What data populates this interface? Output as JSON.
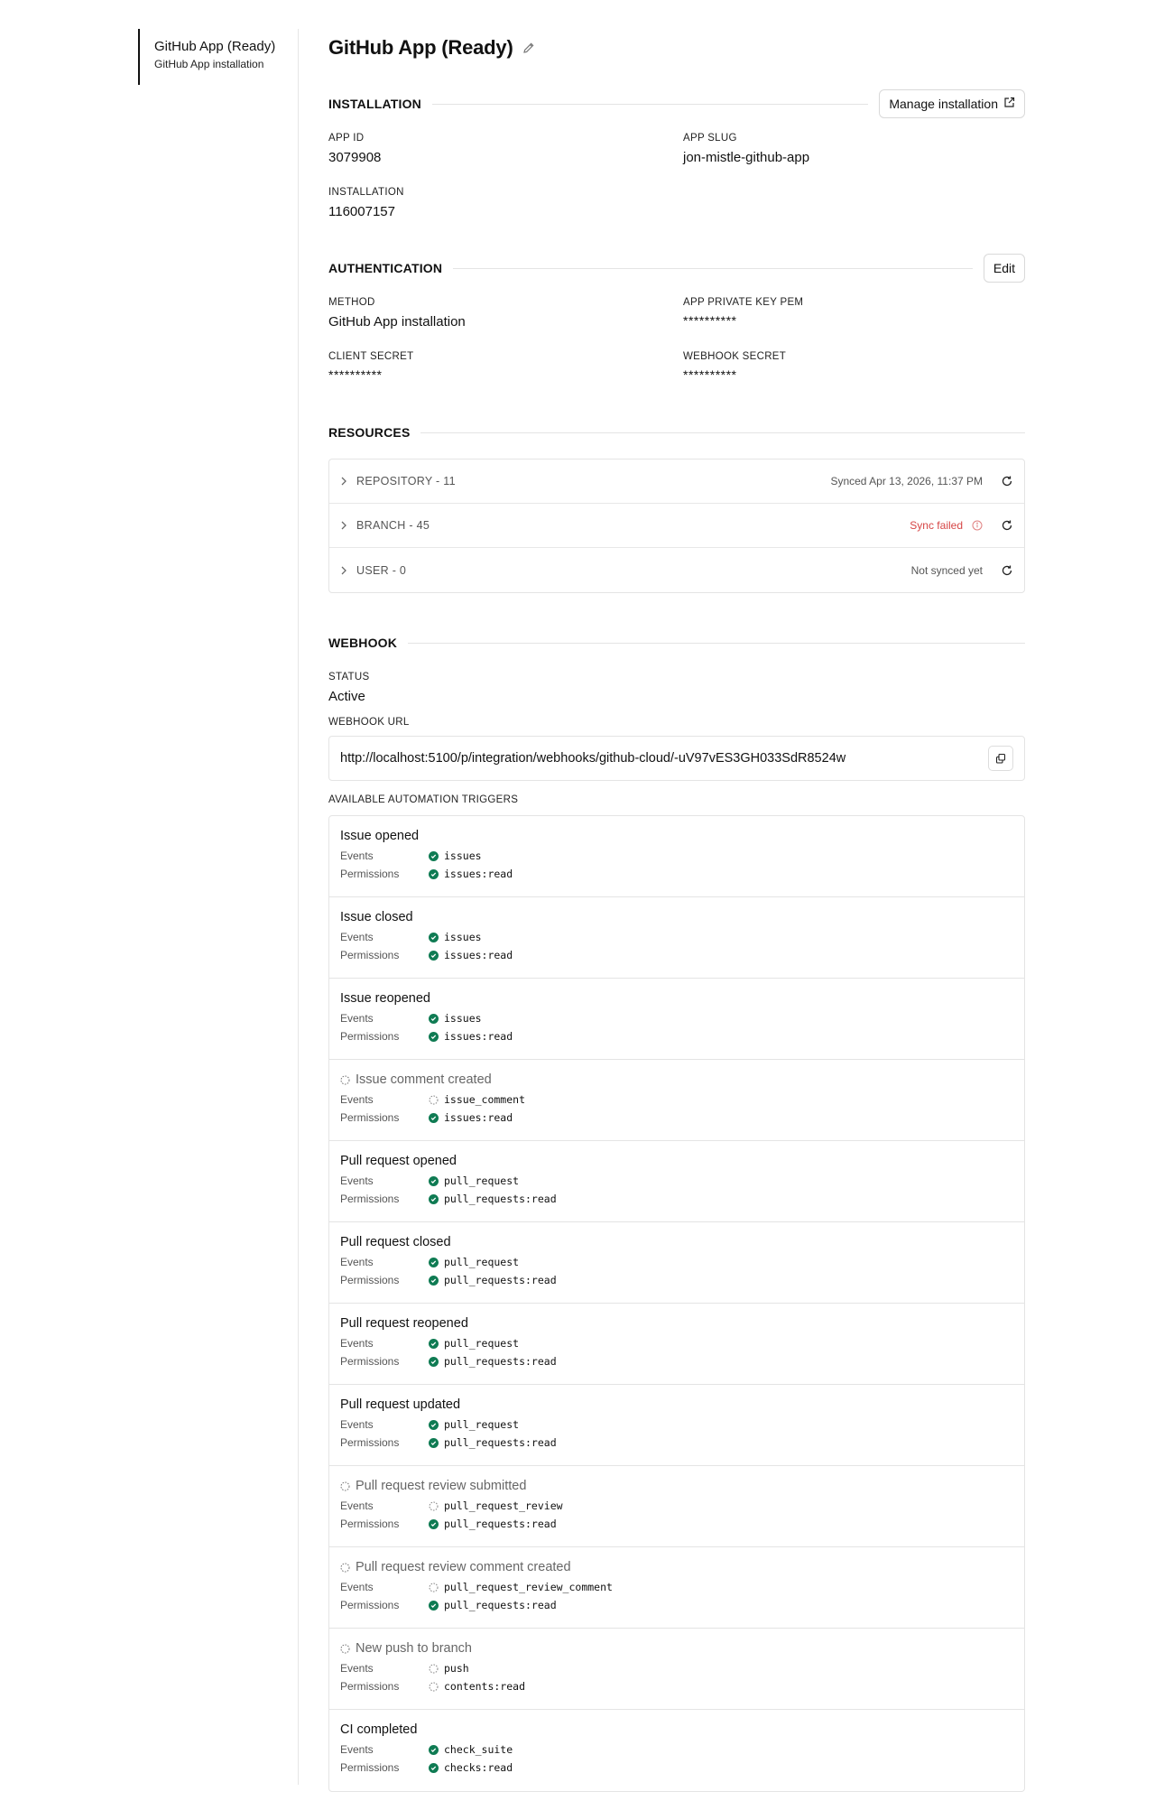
{
  "sidebar": {
    "item_title": "GitHub App (Ready)",
    "item_subtitle": "GitHub App installation"
  },
  "page": {
    "title": "GitHub App (Ready)",
    "edit_icon": "pencil-icon"
  },
  "installation": {
    "heading": "INSTALLATION",
    "manage_button": "Manage installation",
    "app_id_label": "APP ID",
    "app_id": "3079908",
    "app_slug_label": "APP SLUG",
    "app_slug": "jon-mistle-github-app",
    "installation_label": "INSTALLATION",
    "installation_value": "116007157"
  },
  "authentication": {
    "heading": "AUTHENTICATION",
    "edit_button": "Edit",
    "method_label": "METHOD",
    "method_value": "GitHub App installation",
    "pem_label": "APP PRIVATE KEY PEM",
    "pem_value": "**********",
    "client_secret_label": "CLIENT SECRET",
    "client_secret_value": "**********",
    "webhook_secret_label": "WEBHOOK SECRET",
    "webhook_secret_value": "**********"
  },
  "resources": {
    "heading": "RESOURCES",
    "rows": [
      {
        "label": "REPOSITORY - 11",
        "status": "Synced Apr 13, 2026, 11:37 PM",
        "state": "synced"
      },
      {
        "label": "BRANCH - 45",
        "status": "Sync failed",
        "state": "failed"
      },
      {
        "label": "USER - 0",
        "status": "Not synced yet",
        "state": "none"
      }
    ]
  },
  "webhook": {
    "heading": "WEBHOOK",
    "status_label": "STATUS",
    "status_value": "Active",
    "url_label": "WEBHOOK URL",
    "url_value": "http://localhost:5100/p/integration/webhooks/github-cloud/-uV97vES3GH033SdR8524w",
    "triggers_label": "AVAILABLE AUTOMATION TRIGGERS",
    "events_key": "Events",
    "permissions_key": "Permissions"
  },
  "triggers": [
    {
      "name": "Issue opened",
      "pending": false,
      "event": "issues",
      "event_ok": true,
      "permission": "issues:read",
      "permission_ok": true
    },
    {
      "name": "Issue closed",
      "pending": false,
      "event": "issues",
      "event_ok": true,
      "permission": "issues:read",
      "permission_ok": true
    },
    {
      "name": "Issue reopened",
      "pending": false,
      "event": "issues",
      "event_ok": true,
      "permission": "issues:read",
      "permission_ok": true
    },
    {
      "name": "Issue comment created",
      "pending": true,
      "event": "issue_comment",
      "event_ok": false,
      "permission": "issues:read",
      "permission_ok": true
    },
    {
      "name": "Pull request opened",
      "pending": false,
      "event": "pull_request",
      "event_ok": true,
      "permission": "pull_requests:read",
      "permission_ok": true
    },
    {
      "name": "Pull request closed",
      "pending": false,
      "event": "pull_request",
      "event_ok": true,
      "permission": "pull_requests:read",
      "permission_ok": true
    },
    {
      "name": "Pull request reopened",
      "pending": false,
      "event": "pull_request",
      "event_ok": true,
      "permission": "pull_requests:read",
      "permission_ok": true
    },
    {
      "name": "Pull request updated",
      "pending": false,
      "event": "pull_request",
      "event_ok": true,
      "permission": "pull_requests:read",
      "permission_ok": true
    },
    {
      "name": "Pull request review submitted",
      "pending": true,
      "event": "pull_request_review",
      "event_ok": false,
      "permission": "pull_requests:read",
      "permission_ok": true
    },
    {
      "name": "Pull request review comment created",
      "pending": true,
      "event": "pull_request_review_comment",
      "event_ok": false,
      "permission": "pull_requests:read",
      "permission_ok": true
    },
    {
      "name": "New push to branch",
      "pending": true,
      "event": "push",
      "event_ok": false,
      "permission": "contents:read",
      "permission_ok": false
    },
    {
      "name": "CI completed",
      "pending": false,
      "event": "check_suite",
      "event_ok": true,
      "permission": "checks:read",
      "permission_ok": true
    }
  ],
  "colors": {
    "ok": "#0f7b53",
    "failed": "#d64545",
    "border": "#e4e4e4"
  }
}
